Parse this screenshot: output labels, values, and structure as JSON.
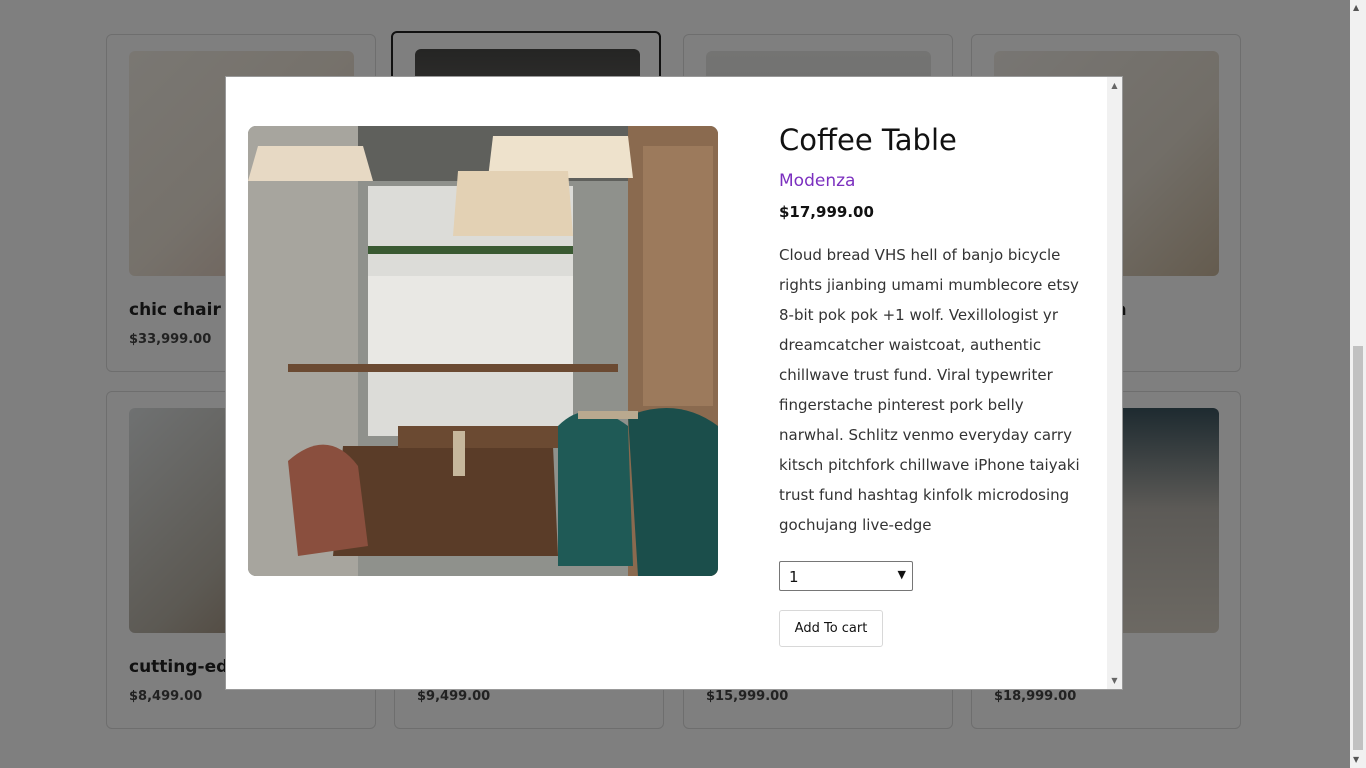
{
  "products": [
    {
      "name": "chic chair",
      "price": "$33,999.00"
    },
    {
      "name": "",
      "price": ""
    },
    {
      "name": "",
      "price": ""
    },
    {
      "name": "ofa",
      "price": ""
    },
    {
      "name": "cutting-edg",
      "price": "$8,499.00"
    },
    {
      "name": "",
      "price": "$9,499.00"
    },
    {
      "name": "",
      "price": "$15,999.00"
    },
    {
      "name": "",
      "price": "$18,999.00"
    }
  ],
  "modal": {
    "title": "Coffee Table",
    "brand": "Modenza",
    "price": "$17,999.00",
    "description": "Cloud bread VHS hell of banjo bicycle rights jianbing umami mumblecore etsy 8-bit pok pok +1 wolf. Vexillologist yr dreamcatcher waistcoat, authentic chillwave trust fund. Viral typewriter fingerstache pinterest pork belly narwhal. Schlitz venmo everyday carry kitsch pitchfork chillwave iPhone taiyaki trust fund hashtag kinfolk microdosing gochujang live-edge",
    "quantity": "1",
    "add_to_cart": "Add To cart"
  },
  "colors": {
    "brand_accent": "#7b2fbf",
    "overlay": "rgba(0,0,0,0.5)"
  }
}
